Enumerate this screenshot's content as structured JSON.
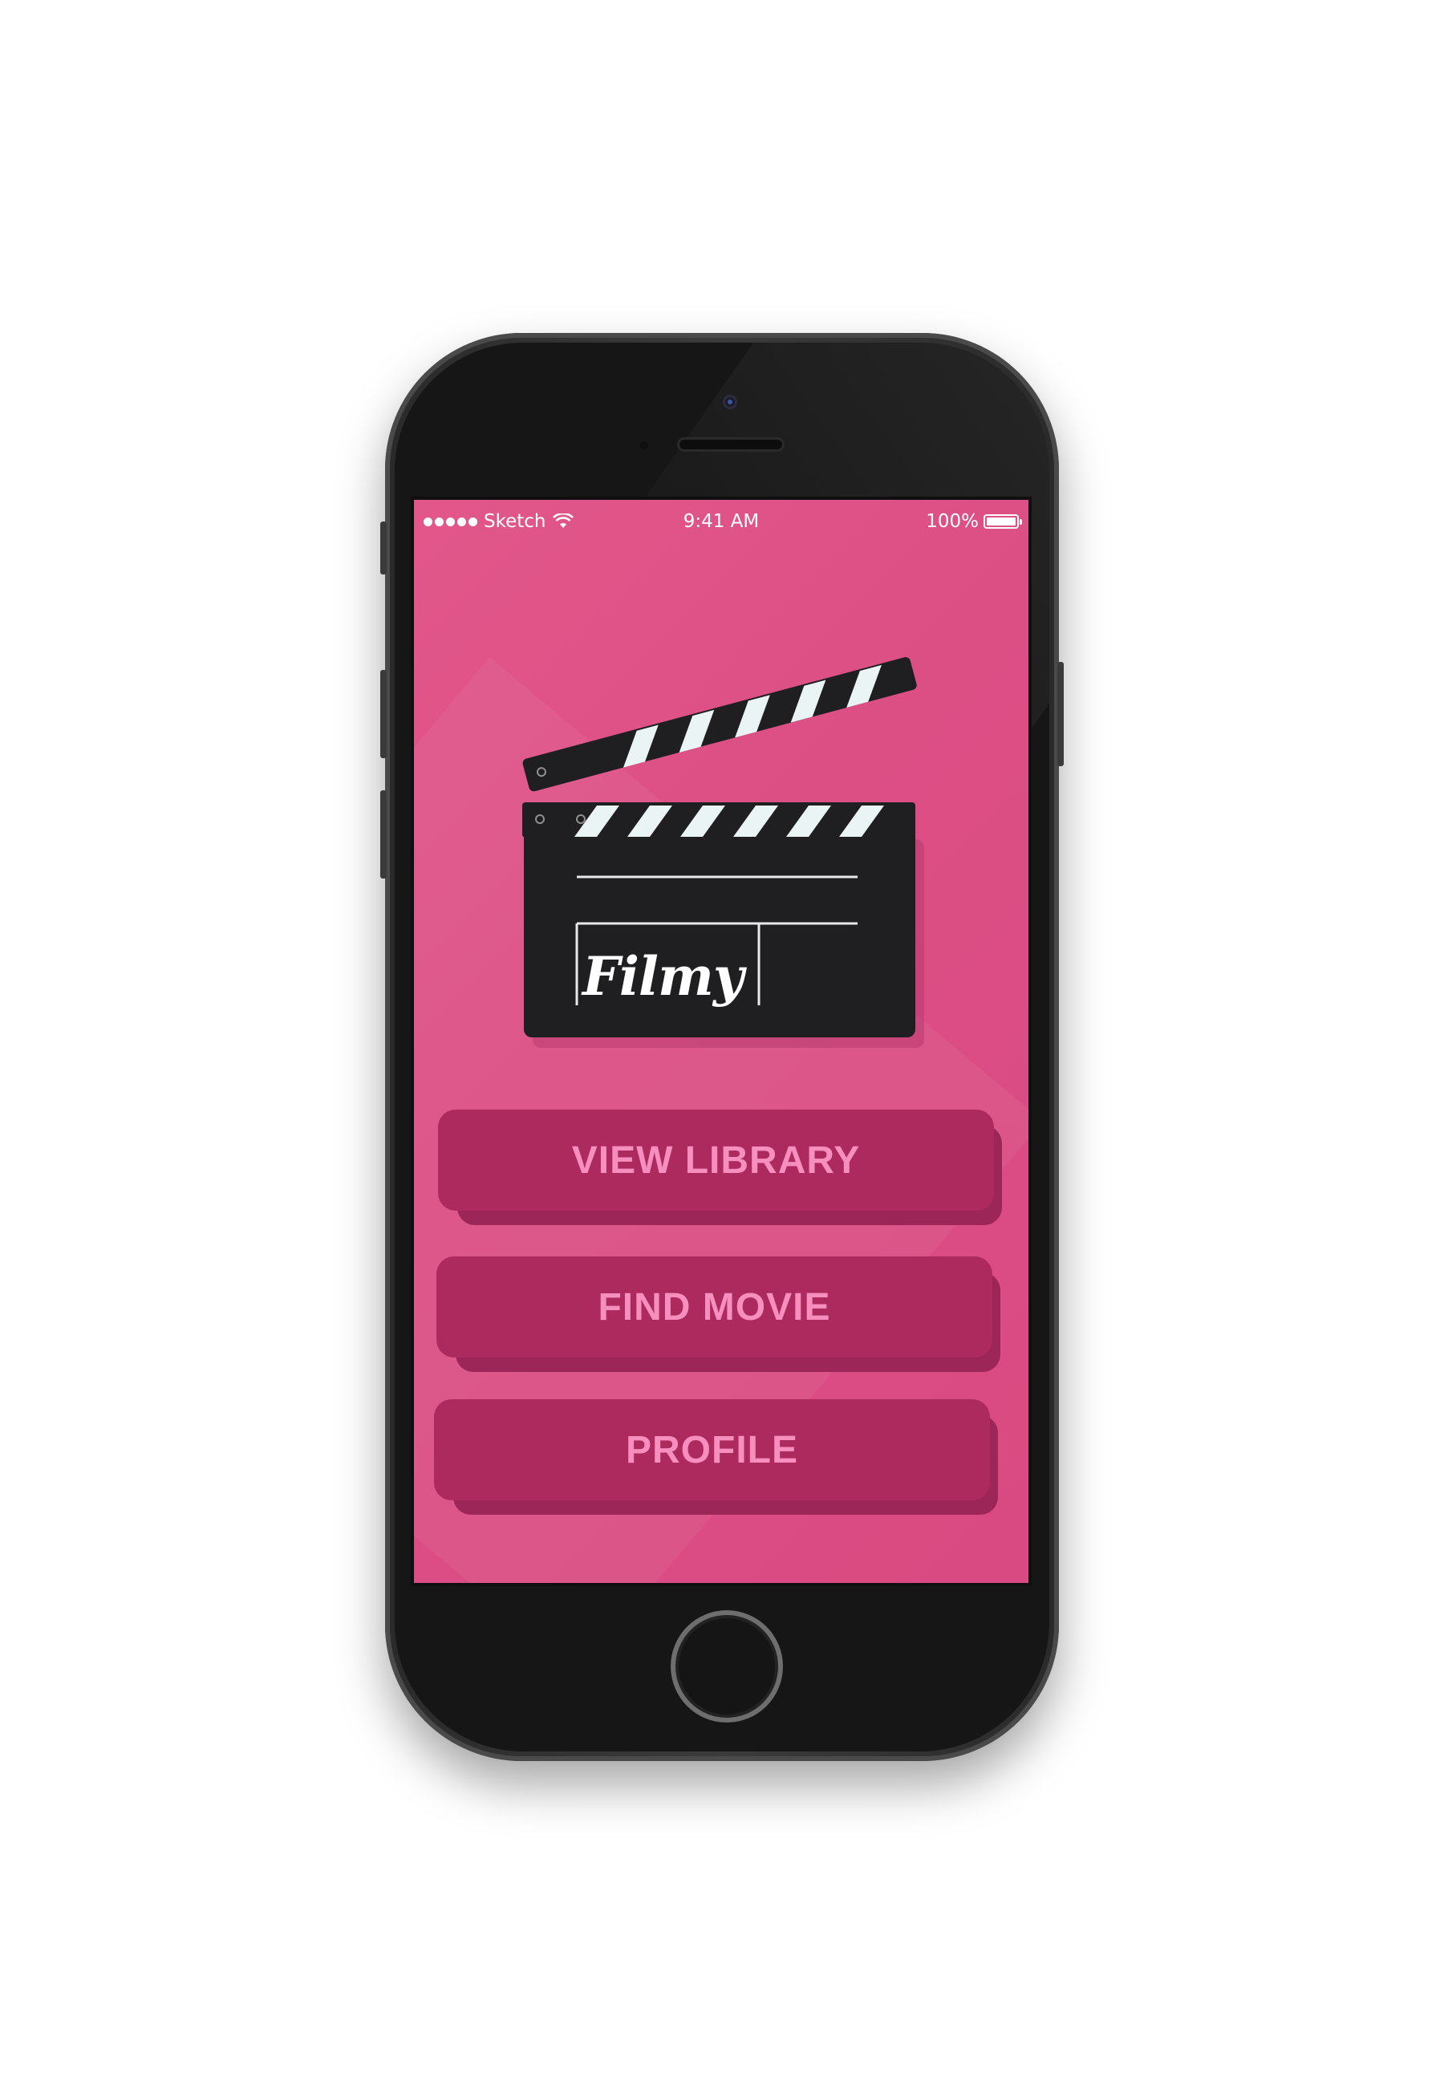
{
  "status_bar": {
    "carrier": "Sketch",
    "time": "9:41 AM",
    "battery": "100%",
    "battery_level": 1.0,
    "signal_dots": 5
  },
  "app": {
    "logo_text": "Filmy",
    "accent_color": "#dc4f85",
    "button_color": "#ad2a5f",
    "button_text_color": "#f68fbd"
  },
  "menu": {
    "view_library": "VIEW LIBRARY",
    "find_movie": "FIND MOVIE",
    "profile": "PROFILE"
  },
  "icons": [
    "wifi-icon",
    "battery-icon",
    "clapperboard-icon"
  ]
}
